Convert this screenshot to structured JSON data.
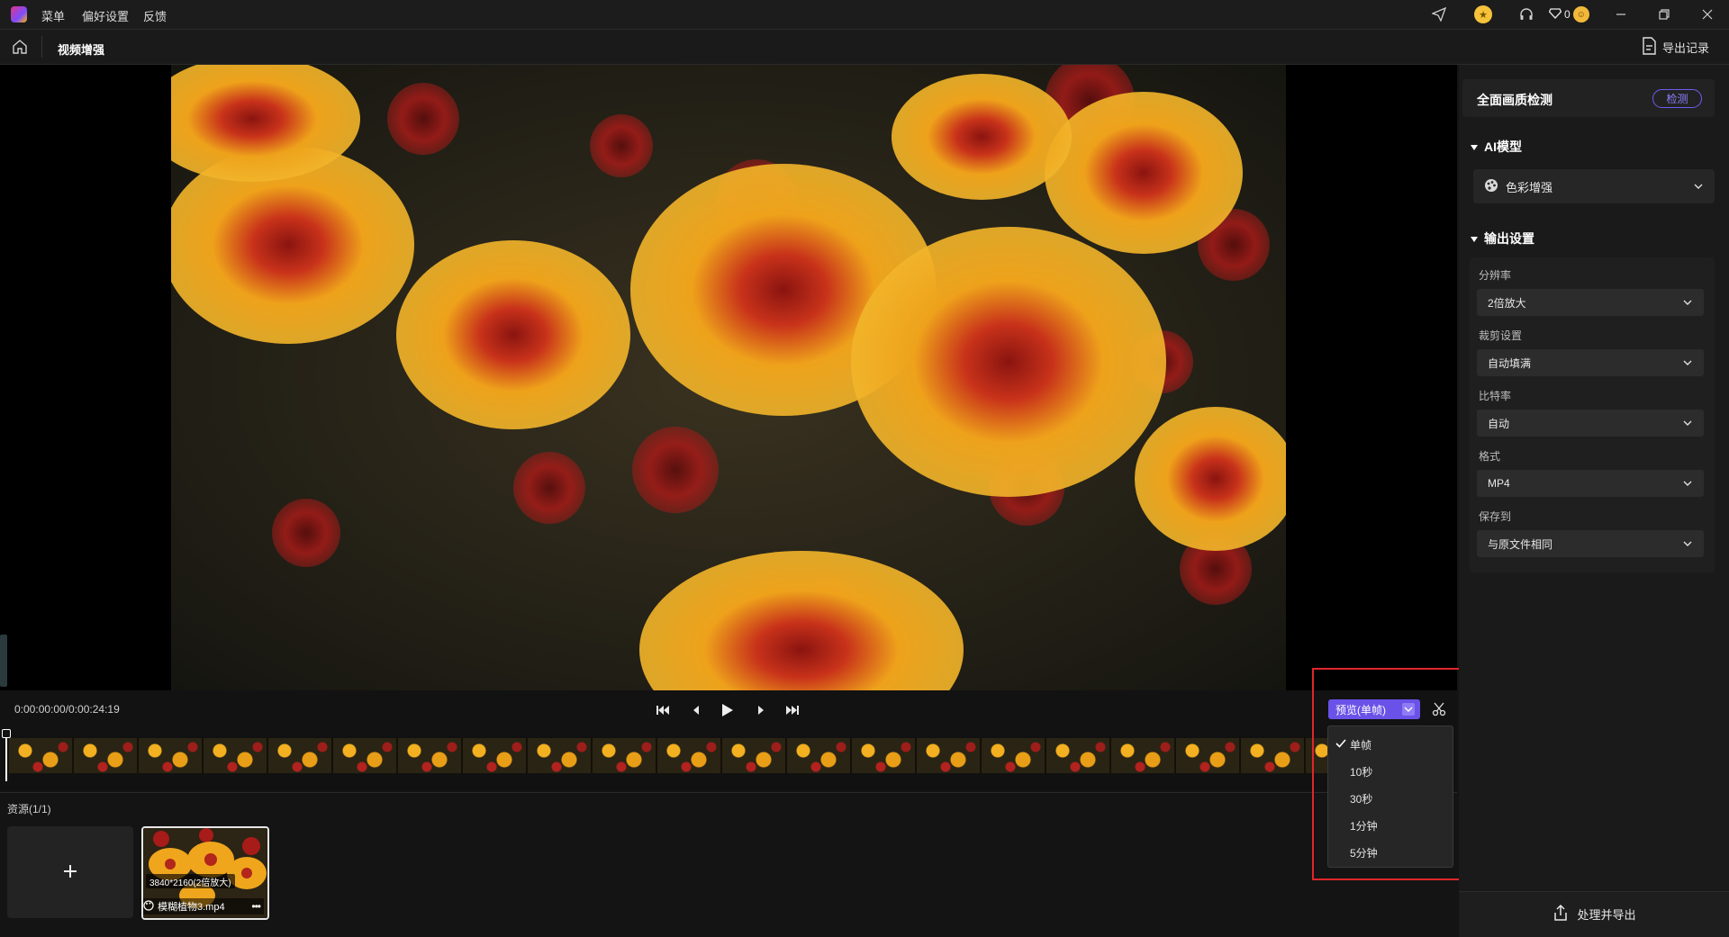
{
  "topbar": {
    "menu_items": [
      "菜单",
      "偏好设置",
      "反馈"
    ],
    "gem_count": "0"
  },
  "navbar": {
    "page_title": "视频增强",
    "export_record": "导出记录"
  },
  "player": {
    "timecode": "0:00:00:00/0:00:24:19"
  },
  "preview_mode": {
    "label": "预览(单帧)",
    "options": [
      "单帧",
      "10秒",
      "30秒",
      "1分钟",
      "5分钟"
    ],
    "selected": "单帧"
  },
  "resources": {
    "label": "资源(1/1)",
    "item": {
      "resolution": "3840*2160(2倍放大)",
      "filename": "模糊植物3.mp4"
    }
  },
  "panel": {
    "quality_title": "全面画质检测",
    "detect_label": "检测",
    "ai_section": "AI模型",
    "ai_model": "色彩增强",
    "output_section": "输出设置",
    "fields": [
      {
        "label": "分辨率",
        "value": "2倍放大"
      },
      {
        "label": "裁剪设置",
        "value": "自动填满"
      },
      {
        "label": "比特率",
        "value": "自动"
      },
      {
        "label": "格式",
        "value": "MP4"
      },
      {
        "label": "保存到",
        "value": "与原文件相同"
      }
    ],
    "process_export": "处理并导出"
  },
  "colors": {
    "accent": "#6a52e8",
    "highlight": "#e0262b"
  }
}
